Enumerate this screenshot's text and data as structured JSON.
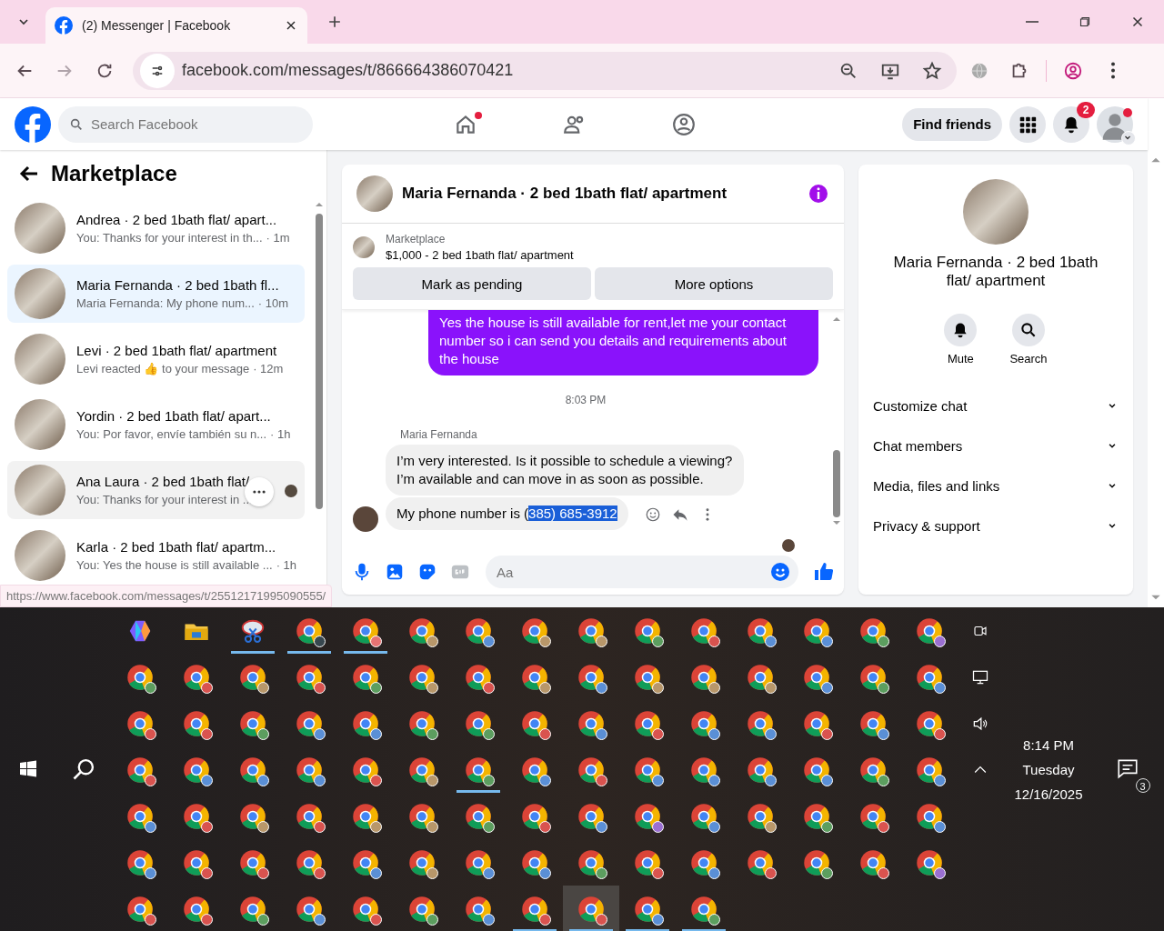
{
  "browser": {
    "tab": {
      "title": "(2) Messenger | Facebook"
    },
    "url": "facebook.com/messages/t/866664386070421",
    "status_url": "https://www.facebook.com/messages/t/25512171995090555/"
  },
  "header": {
    "search": {
      "placeholder": "Search Facebook"
    },
    "nav": [
      {
        "kind": "home",
        "dot": true
      },
      {
        "kind": "friends",
        "dot": false
      },
      {
        "kind": "groups",
        "dot": false
      }
    ],
    "find_friends": "Find friends",
    "notifications": "2"
  },
  "sidebar": {
    "title": "Marketplace",
    "conversations": [
      {
        "name": "Andrea · 2 bed 1bath flat/ apart...",
        "snippet": "You: Thanks for your interest in th...",
        "time": "· 1m",
        "selected": false,
        "hovered": false
      },
      {
        "name": "Maria Fernanda · 2 bed 1bath fl...",
        "snippet": "Maria Fernanda: My phone num...",
        "time": "· 10m",
        "selected": true,
        "hovered": false
      },
      {
        "name": "Levi · 2 bed 1bath flat/ apartment",
        "snippet": "Levi reacted 👍 to your message",
        "time": "· 12m",
        "selected": false,
        "hovered": false
      },
      {
        "name": "Yordin · 2 bed 1bath flat/ apart...",
        "snippet": "You: Por favor, envíe también su n...",
        "time": "· 1h",
        "selected": false,
        "hovered": false
      },
      {
        "name": "Ana Laura · 2 bed 1bath flat/",
        "snippet": "You: Thanks for your interest in ...",
        "selected": false,
        "hovered": true
      },
      {
        "name": "Karla · 2 bed 1bath flat/ apartm...",
        "snippet": "You: Yes the house is still available ...",
        "time": "· 1h",
        "selected": false,
        "hovered": false
      }
    ]
  },
  "chat": {
    "title": "Maria Fernanda · 2 bed 1bath flat/ apartment",
    "listing": {
      "label": "Marketplace",
      "title": "$1,000 - 2 bed 1bath flat/ apartment"
    },
    "actions": [
      "Mark as pending",
      "More options"
    ],
    "messages": [
      {
        "kind": "outgoing",
        "text": "Yes the house is still available for rent,let me your contact number so i can send you details and requirements about the house"
      },
      {
        "kind": "time",
        "text": "8:03 PM"
      },
      {
        "kind": "sender",
        "text": "Maria Fernanda"
      },
      {
        "kind": "incoming",
        "text": "I’m very interested. Is it possible to schedule a viewing? I’m available and can move in as soon as possible."
      },
      {
        "kind": "incoming_last",
        "text": "My phone number is (",
        "selection": "385) 685-3912"
      }
    ],
    "composer": {
      "placeholder": "Aa"
    }
  },
  "details": {
    "title": "Maria Fernanda · 2 bed 1bath flat/ apartment",
    "actions": [
      {
        "kind": "mute",
        "label": "Mute"
      },
      {
        "kind": "search",
        "label": "Search"
      }
    ],
    "sections": [
      {
        "label": "Customize chat",
        "expanded": false
      },
      {
        "label": "Chat members",
        "expanded": false
      },
      {
        "label": "Media, files and links",
        "expanded": false
      },
      {
        "label": "Privacy & support",
        "expanded": false
      }
    ]
  },
  "taskbar": {
    "apps": [
      {
        "kind": "copilot",
        "running": false,
        "active": false
      },
      {
        "kind": "folder",
        "running": false,
        "active": false
      },
      {
        "kind": "snip",
        "running": true,
        "active": false
      },
      {
        "kind": "chrome",
        "color": "#37474f",
        "running": true,
        "active": false
      },
      {
        "kind": "chrome",
        "color": "#e57373",
        "running": true,
        "active": false
      },
      {
        "kind": "chrome",
        "color": "#b8976a",
        "running": false,
        "active": false
      },
      {
        "kind": "chrome",
        "color": "#5a8fd6",
        "running": false,
        "active": false
      },
      {
        "kind": "chrome",
        "color": "#b8976a",
        "running": false,
        "active": false
      },
      {
        "kind": "chrome",
        "color": "#b8976a",
        "running": false,
        "active": false
      },
      {
        "kind": "chrome",
        "color": "#5c9e5f",
        "running": false,
        "active": false
      },
      {
        "kind": "chrome",
        "color": "#d9534f",
        "running": false,
        "active": false
      },
      {
        "kind": "chrome",
        "color": "#5a8fd6",
        "running": false,
        "active": false
      },
      {
        "kind": "chrome",
        "color": "#5a8fd6",
        "running": false,
        "active": false
      },
      {
        "kind": "chrome",
        "color": "#5c9e5f",
        "running": false,
        "active": false
      },
      {
        "kind": "chrome",
        "color": "#9a6fd1",
        "running": false,
        "active": false
      },
      {
        "kind": "chrome",
        "color": "#5c9e5f",
        "running": false,
        "active": false
      },
      {
        "kind": "chrome",
        "color": "#d9534f",
        "running": false,
        "active": false
      },
      {
        "kind": "chrome",
        "color": "#b8976a",
        "running": false,
        "active": false
      },
      {
        "kind": "chrome",
        "color": "#d9534f",
        "running": false,
        "active": false
      },
      {
        "kind": "chrome",
        "color": "#5c9e5f",
        "running": false,
        "active": false
      },
      {
        "kind": "chrome",
        "color": "#b8976a",
        "running": false,
        "active": false
      },
      {
        "kind": "chrome",
        "color": "#d9534f",
        "running": false,
        "active": false
      },
      {
        "kind": "chrome",
        "color": "#b8976a",
        "running": false,
        "active": false
      },
      {
        "kind": "chrome",
        "color": "#5a8fd6",
        "running": false,
        "active": false
      },
      {
        "kind": "chrome",
        "color": "#b8976a",
        "running": false,
        "active": false
      },
      {
        "kind": "chrome",
        "color": "#b8976a",
        "running": false,
        "active": false
      },
      {
        "kind": "chrome",
        "color": "#b8976a",
        "running": false,
        "active": false
      },
      {
        "kind": "chrome",
        "color": "#5a8fd6",
        "running": false,
        "active": false
      },
      {
        "kind": "chrome",
        "color": "#5c9e5f",
        "running": false,
        "active": false
      },
      {
        "kind": "chrome",
        "color": "#5a8fd6",
        "running": false,
        "active": false
      },
      {
        "kind": "chrome",
        "color": "#d9534f",
        "running": false,
        "active": false
      },
      {
        "kind": "chrome",
        "color": "#d9534f",
        "running": false,
        "active": false
      },
      {
        "kind": "chrome",
        "color": "#5c9e5f",
        "running": false,
        "active": false
      },
      {
        "kind": "chrome",
        "color": "#5a8fd6",
        "running": false,
        "active": false
      },
      {
        "kind": "chrome",
        "color": "#5a8fd6",
        "running": false,
        "active": false
      },
      {
        "kind": "chrome",
        "color": "#5c9e5f",
        "running": false,
        "active": false
      },
      {
        "kind": "chrome",
        "color": "#5c9e5f",
        "running": false,
        "active": false
      },
      {
        "kind": "chrome",
        "color": "#d9534f",
        "running": false,
        "active": false
      },
      {
        "kind": "chrome",
        "color": "#5a8fd6",
        "running": false,
        "active": false
      },
      {
        "kind": "chrome",
        "color": "#d9534f",
        "running": false,
        "active": false
      },
      {
        "kind": "chrome",
        "color": "#5a8fd6",
        "running": false,
        "active": false
      },
      {
        "kind": "chrome",
        "color": "#5a8fd6",
        "running": false,
        "active": false
      },
      {
        "kind": "chrome",
        "color": "#d9534f",
        "running": false,
        "active": false
      },
      {
        "kind": "chrome",
        "color": "#5a8fd6",
        "running": false,
        "active": false
      },
      {
        "kind": "chrome",
        "color": "#d9534f",
        "running": false,
        "active": false
      },
      {
        "kind": "chrome",
        "color": "#d9534f",
        "running": false,
        "active": false
      },
      {
        "kind": "chrome",
        "color": "#5a8fd6",
        "running": false,
        "active": false
      },
      {
        "kind": "chrome",
        "color": "#5a8fd6",
        "running": false,
        "active": false
      },
      {
        "kind": "chrome",
        "color": "#5a8fd6",
        "running": false,
        "active": false
      },
      {
        "kind": "chrome",
        "color": "#d9534f",
        "running": false,
        "active": false
      },
      {
        "kind": "chrome",
        "color": "#b8976a",
        "running": false,
        "active": false
      },
      {
        "kind": "chrome",
        "color": "#5c9e5f",
        "running": true,
        "active": false
      },
      {
        "kind": "chrome",
        "color": "#5a8fd6",
        "running": false,
        "active": false
      },
      {
        "kind": "chrome",
        "color": "#d9534f",
        "running": false,
        "active": false
      },
      {
        "kind": "chrome",
        "color": "#5a8fd6",
        "running": false,
        "active": false
      },
      {
        "kind": "chrome",
        "color": "#5a8fd6",
        "running": false,
        "active": false
      },
      {
        "kind": "chrome",
        "color": "#5a8fd6",
        "running": false,
        "active": false
      },
      {
        "kind": "chrome",
        "color": "#5a8fd6",
        "running": false,
        "active": false
      },
      {
        "kind": "chrome",
        "color": "#5c9e5f",
        "running": false,
        "active": false
      },
      {
        "kind": "chrome",
        "color": "#5a8fd6",
        "running": false,
        "active": false
      },
      {
        "kind": "chrome",
        "color": "#5a8fd6",
        "running": false,
        "active": false
      },
      {
        "kind": "chrome",
        "color": "#d9534f",
        "running": false,
        "active": false
      },
      {
        "kind": "chrome",
        "color": "#b8976a",
        "running": false,
        "active": false
      },
      {
        "kind": "chrome",
        "color": "#d9534f",
        "running": false,
        "active": false
      },
      {
        "kind": "chrome",
        "color": "#b8976a",
        "running": false,
        "active": false
      },
      {
        "kind": "chrome",
        "color": "#b8976a",
        "running": false,
        "active": false
      },
      {
        "kind": "chrome",
        "color": "#5c9e5f",
        "running": false,
        "active": false
      },
      {
        "kind": "chrome",
        "color": "#d9534f",
        "running": false,
        "active": false
      },
      {
        "kind": "chrome",
        "color": "#5a8fd6",
        "running": false,
        "active": false
      },
      {
        "kind": "chrome",
        "color": "#9a6fd1",
        "running": false,
        "active": false
      },
      {
        "kind": "chrome",
        "color": "#5a8fd6",
        "running": false,
        "active": false
      },
      {
        "kind": "chrome",
        "color": "#b8976a",
        "running": false,
        "active": false
      },
      {
        "kind": "chrome",
        "color": "#5c9e5f",
        "running": false,
        "active": false
      },
      {
        "kind": "chrome",
        "color": "#d9534f",
        "running": false,
        "active": false
      },
      {
        "kind": "chrome",
        "color": "#5a8fd6",
        "running": false,
        "active": false
      },
      {
        "kind": "chrome",
        "color": "#5a8fd6",
        "running": false,
        "active": false
      },
      {
        "kind": "chrome",
        "color": "#d9534f",
        "running": false,
        "active": false
      },
      {
        "kind": "chrome",
        "color": "#d9534f",
        "running": false,
        "active": false
      },
      {
        "kind": "chrome",
        "color": "#d9534f",
        "running": false,
        "active": false
      },
      {
        "kind": "chrome",
        "color": "#5a8fd6",
        "running": false,
        "active": false
      },
      {
        "kind": "chrome",
        "color": "#b8976a",
        "running": false,
        "active": false
      },
      {
        "kind": "chrome",
        "color": "#5a8fd6",
        "running": false,
        "active": false
      },
      {
        "kind": "chrome",
        "color": "#5a8fd6",
        "running": false,
        "active": false
      },
      {
        "kind": "chrome",
        "color": "#5c9e5f",
        "running": false,
        "active": false
      },
      {
        "kind": "chrome",
        "color": "#d9534f",
        "running": false,
        "active": false
      },
      {
        "kind": "chrome",
        "color": "#5a8fd6",
        "running": false,
        "active": false
      },
      {
        "kind": "chrome",
        "color": "#d9534f",
        "running": false,
        "active": false
      },
      {
        "kind": "chrome",
        "color": "#5c9e5f",
        "running": false,
        "active": false
      },
      {
        "kind": "chrome",
        "color": "#d9534f",
        "running": false,
        "active": false
      },
      {
        "kind": "chrome",
        "color": "#9a6fd1",
        "running": false,
        "active": false
      },
      {
        "kind": "chrome",
        "color": "#d9534f",
        "running": false,
        "active": false
      },
      {
        "kind": "chrome",
        "color": "#d9534f",
        "running": false,
        "active": false
      },
      {
        "kind": "chrome",
        "color": "#5c9e5f",
        "running": false,
        "active": false
      },
      {
        "kind": "chrome",
        "color": "#5a8fd6",
        "running": false,
        "active": false
      },
      {
        "kind": "chrome",
        "color": "#d9534f",
        "running": false,
        "active": false
      },
      {
        "kind": "chrome",
        "color": "#5c9e5f",
        "running": false,
        "active": false
      },
      {
        "kind": "chrome",
        "color": "#5a8fd6",
        "running": false,
        "active": false
      },
      {
        "kind": "chrome",
        "color": "#d9534f",
        "running": true,
        "active": false
      },
      {
        "kind": "chrome",
        "color": "#d9534f",
        "running": true,
        "active": true
      },
      {
        "kind": "chrome",
        "color": "#5a8fd6",
        "running": true,
        "active": false
      },
      {
        "kind": "chrome",
        "color": "#5c9e5f",
        "running": true,
        "active": false
      }
    ],
    "clock": {
      "time": "8:14 PM",
      "day": "Tuesday",
      "date": "12/16/2025"
    },
    "notifications": "3"
  }
}
